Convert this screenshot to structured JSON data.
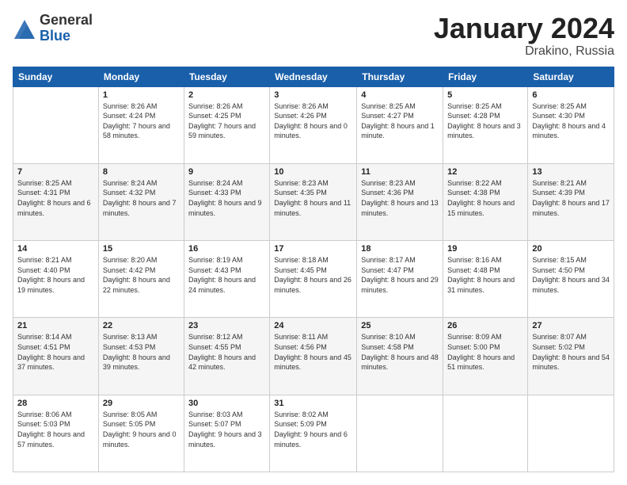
{
  "header": {
    "logo_general": "General",
    "logo_blue": "Blue",
    "month_title": "January 2024",
    "location": "Drakino, Russia"
  },
  "weekdays": [
    "Sunday",
    "Monday",
    "Tuesday",
    "Wednesday",
    "Thursday",
    "Friday",
    "Saturday"
  ],
  "weeks": [
    [
      {
        "day": "",
        "sunrise": "",
        "sunset": "",
        "daylight": ""
      },
      {
        "day": "1",
        "sunrise": "Sunrise: 8:26 AM",
        "sunset": "Sunset: 4:24 PM",
        "daylight": "Daylight: 7 hours and 58 minutes."
      },
      {
        "day": "2",
        "sunrise": "Sunrise: 8:26 AM",
        "sunset": "Sunset: 4:25 PM",
        "daylight": "Daylight: 7 hours and 59 minutes."
      },
      {
        "day": "3",
        "sunrise": "Sunrise: 8:26 AM",
        "sunset": "Sunset: 4:26 PM",
        "daylight": "Daylight: 8 hours and 0 minutes."
      },
      {
        "day": "4",
        "sunrise": "Sunrise: 8:25 AM",
        "sunset": "Sunset: 4:27 PM",
        "daylight": "Daylight: 8 hours and 1 minute."
      },
      {
        "day": "5",
        "sunrise": "Sunrise: 8:25 AM",
        "sunset": "Sunset: 4:28 PM",
        "daylight": "Daylight: 8 hours and 3 minutes."
      },
      {
        "day": "6",
        "sunrise": "Sunrise: 8:25 AM",
        "sunset": "Sunset: 4:30 PM",
        "daylight": "Daylight: 8 hours and 4 minutes."
      }
    ],
    [
      {
        "day": "7",
        "sunrise": "Sunrise: 8:25 AM",
        "sunset": "Sunset: 4:31 PM",
        "daylight": "Daylight: 8 hours and 6 minutes."
      },
      {
        "day": "8",
        "sunrise": "Sunrise: 8:24 AM",
        "sunset": "Sunset: 4:32 PM",
        "daylight": "Daylight: 8 hours and 7 minutes."
      },
      {
        "day": "9",
        "sunrise": "Sunrise: 8:24 AM",
        "sunset": "Sunset: 4:33 PM",
        "daylight": "Daylight: 8 hours and 9 minutes."
      },
      {
        "day": "10",
        "sunrise": "Sunrise: 8:23 AM",
        "sunset": "Sunset: 4:35 PM",
        "daylight": "Daylight: 8 hours and 11 minutes."
      },
      {
        "day": "11",
        "sunrise": "Sunrise: 8:23 AM",
        "sunset": "Sunset: 4:36 PM",
        "daylight": "Daylight: 8 hours and 13 minutes."
      },
      {
        "day": "12",
        "sunrise": "Sunrise: 8:22 AM",
        "sunset": "Sunset: 4:38 PM",
        "daylight": "Daylight: 8 hours and 15 minutes."
      },
      {
        "day": "13",
        "sunrise": "Sunrise: 8:21 AM",
        "sunset": "Sunset: 4:39 PM",
        "daylight": "Daylight: 8 hours and 17 minutes."
      }
    ],
    [
      {
        "day": "14",
        "sunrise": "Sunrise: 8:21 AM",
        "sunset": "Sunset: 4:40 PM",
        "daylight": "Daylight: 8 hours and 19 minutes."
      },
      {
        "day": "15",
        "sunrise": "Sunrise: 8:20 AM",
        "sunset": "Sunset: 4:42 PM",
        "daylight": "Daylight: 8 hours and 22 minutes."
      },
      {
        "day": "16",
        "sunrise": "Sunrise: 8:19 AM",
        "sunset": "Sunset: 4:43 PM",
        "daylight": "Daylight: 8 hours and 24 minutes."
      },
      {
        "day": "17",
        "sunrise": "Sunrise: 8:18 AM",
        "sunset": "Sunset: 4:45 PM",
        "daylight": "Daylight: 8 hours and 26 minutes."
      },
      {
        "day": "18",
        "sunrise": "Sunrise: 8:17 AM",
        "sunset": "Sunset: 4:47 PM",
        "daylight": "Daylight: 8 hours and 29 minutes."
      },
      {
        "day": "19",
        "sunrise": "Sunrise: 8:16 AM",
        "sunset": "Sunset: 4:48 PM",
        "daylight": "Daylight: 8 hours and 31 minutes."
      },
      {
        "day": "20",
        "sunrise": "Sunrise: 8:15 AM",
        "sunset": "Sunset: 4:50 PM",
        "daylight": "Daylight: 8 hours and 34 minutes."
      }
    ],
    [
      {
        "day": "21",
        "sunrise": "Sunrise: 8:14 AM",
        "sunset": "Sunset: 4:51 PM",
        "daylight": "Daylight: 8 hours and 37 minutes."
      },
      {
        "day": "22",
        "sunrise": "Sunrise: 8:13 AM",
        "sunset": "Sunset: 4:53 PM",
        "daylight": "Daylight: 8 hours and 39 minutes."
      },
      {
        "day": "23",
        "sunrise": "Sunrise: 8:12 AM",
        "sunset": "Sunset: 4:55 PM",
        "daylight": "Daylight: 8 hours and 42 minutes."
      },
      {
        "day": "24",
        "sunrise": "Sunrise: 8:11 AM",
        "sunset": "Sunset: 4:56 PM",
        "daylight": "Daylight: 8 hours and 45 minutes."
      },
      {
        "day": "25",
        "sunrise": "Sunrise: 8:10 AM",
        "sunset": "Sunset: 4:58 PM",
        "daylight": "Daylight: 8 hours and 48 minutes."
      },
      {
        "day": "26",
        "sunrise": "Sunrise: 8:09 AM",
        "sunset": "Sunset: 5:00 PM",
        "daylight": "Daylight: 8 hours and 51 minutes."
      },
      {
        "day": "27",
        "sunrise": "Sunrise: 8:07 AM",
        "sunset": "Sunset: 5:02 PM",
        "daylight": "Daylight: 8 hours and 54 minutes."
      }
    ],
    [
      {
        "day": "28",
        "sunrise": "Sunrise: 8:06 AM",
        "sunset": "Sunset: 5:03 PM",
        "daylight": "Daylight: 8 hours and 57 minutes."
      },
      {
        "day": "29",
        "sunrise": "Sunrise: 8:05 AM",
        "sunset": "Sunset: 5:05 PM",
        "daylight": "Daylight: 9 hours and 0 minutes."
      },
      {
        "day": "30",
        "sunrise": "Sunrise: 8:03 AM",
        "sunset": "Sunset: 5:07 PM",
        "daylight": "Daylight: 9 hours and 3 minutes."
      },
      {
        "day": "31",
        "sunrise": "Sunrise: 8:02 AM",
        "sunset": "Sunset: 5:09 PM",
        "daylight": "Daylight: 9 hours and 6 minutes."
      },
      {
        "day": "",
        "sunrise": "",
        "sunset": "",
        "daylight": ""
      },
      {
        "day": "",
        "sunrise": "",
        "sunset": "",
        "daylight": ""
      },
      {
        "day": "",
        "sunrise": "",
        "sunset": "",
        "daylight": ""
      }
    ]
  ]
}
